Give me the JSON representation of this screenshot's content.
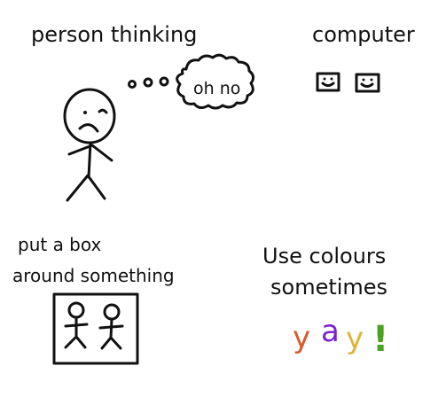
{
  "labels": {
    "person_thinking": "person thinking",
    "computer": "computer",
    "thought": "oh no",
    "box_line1": "put a box",
    "box_line2": "around something",
    "colours_line1": "Use colours",
    "colours_line2": "sometimes"
  },
  "yay": [
    {
      "char": "y",
      "color": "#d9572b"
    },
    {
      "char": "a",
      "color": "#7a22d0"
    },
    {
      "char": "y",
      "color": "#e0b23a"
    },
    {
      "char": "!",
      "color": "#4aa322"
    }
  ],
  "icons": [
    "stick-figure-sad",
    "thought-cloud",
    "smiley-computer-screen",
    "stick-figure"
  ]
}
